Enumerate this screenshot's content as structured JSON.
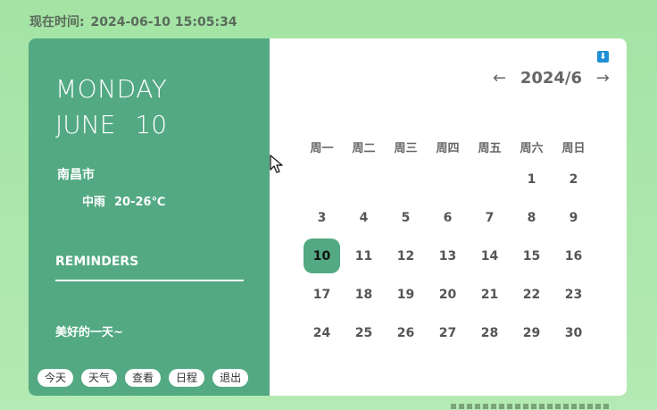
{
  "header": {
    "label": "现在时间:",
    "datetime": "2024-06-10  15:05:34"
  },
  "left": {
    "weekday": "MONDAY",
    "month": "JUNE",
    "day": "10",
    "city": "南昌市",
    "weather": {
      "condition": "中雨",
      "temp": "20-26℃"
    },
    "reminders_title": "REMINDERS",
    "reminder_text": "美好的一天~",
    "buttons": [
      "今天",
      "天气",
      "查看",
      "日程",
      "退出"
    ]
  },
  "calendar": {
    "prev": "←",
    "next": "→",
    "year_month": "2024/6",
    "weekdays": [
      "周一",
      "周二",
      "周三",
      "周四",
      "周五",
      "周六",
      "周日"
    ],
    "weeks": [
      [
        "",
        "",
        "",
        "",
        "",
        "1",
        "2"
      ],
      [
        "3",
        "4",
        "5",
        "6",
        "7",
        "8",
        "9"
      ],
      [
        "10",
        "11",
        "12",
        "13",
        "14",
        "15",
        "16"
      ],
      [
        "17",
        "18",
        "19",
        "20",
        "21",
        "22",
        "23"
      ],
      [
        "24",
        "25",
        "26",
        "27",
        "28",
        "29",
        "30"
      ]
    ],
    "today": "10",
    "download_icon": "download-icon"
  },
  "colors": {
    "accent": "#53a982",
    "bg": "#a8e5a7"
  }
}
